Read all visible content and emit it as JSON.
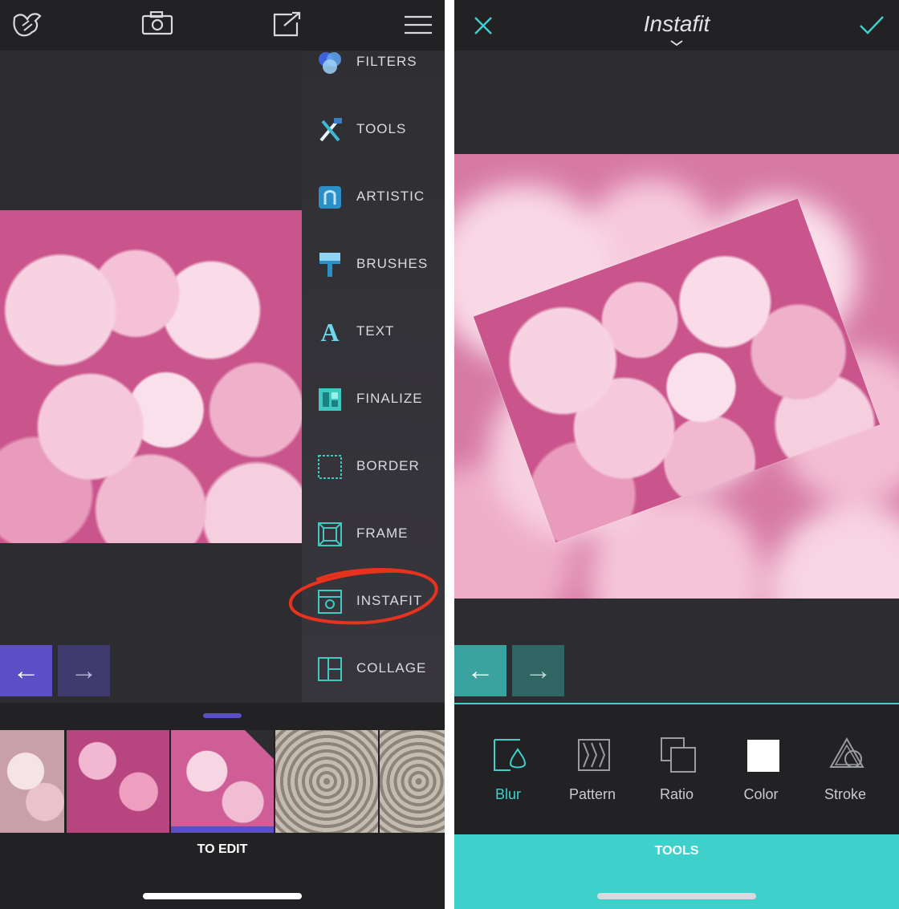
{
  "left": {
    "menu": [
      {
        "label": "FILTERS",
        "icon": "filters-icon"
      },
      {
        "label": "TOOLS",
        "icon": "tools-icon"
      },
      {
        "label": "ARTISTIC",
        "icon": "artistic-icon"
      },
      {
        "label": "BRUSHES",
        "icon": "brushes-icon"
      },
      {
        "label": "TEXT",
        "icon": "text-icon"
      },
      {
        "label": "FINALIZE",
        "icon": "finalize-icon"
      },
      {
        "label": "BORDER",
        "icon": "border-icon"
      },
      {
        "label": "FRAME",
        "icon": "frame-icon"
      },
      {
        "label": "INSTAFIT",
        "icon": "instafit-icon"
      },
      {
        "label": "COLLAGE",
        "icon": "collage-icon"
      }
    ],
    "text_icon_glyph": "A",
    "back_arrow": "←",
    "forward_arrow": "→",
    "to_edit_label": "TO EDIT"
  },
  "right": {
    "title": "Instafit",
    "back_arrow": "←",
    "forward_arrow": "→",
    "tools": [
      {
        "label": "Blur",
        "icon": "blur-icon",
        "active": true
      },
      {
        "label": "Pattern",
        "icon": "pattern-icon",
        "active": false
      },
      {
        "label": "Ratio",
        "icon": "ratio-icon",
        "active": false
      },
      {
        "label": "Color",
        "icon": "color-icon",
        "active": false
      },
      {
        "label": "Stroke",
        "icon": "stroke-icon",
        "active": false
      }
    ],
    "tools_tab_label": "TOOLS"
  },
  "colors": {
    "accent_teal": "#3ed1cc",
    "accent_purple": "#5a4fc4",
    "annotation_red": "#e8321e"
  }
}
